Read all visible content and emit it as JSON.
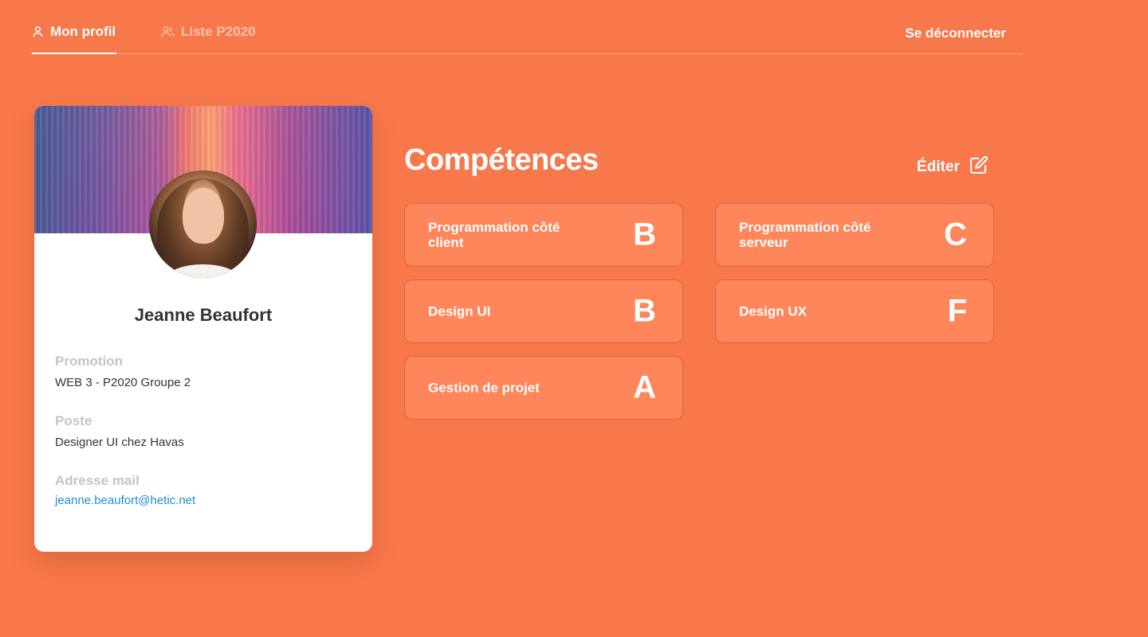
{
  "nav": {
    "tabs": [
      {
        "label": "Mon profil",
        "icon": "user-icon",
        "active": true
      },
      {
        "label": "Liste P2020",
        "icon": "users-icon",
        "active": false
      }
    ],
    "logout_label": "Se déconnecter"
  },
  "profile": {
    "name": "Jeanne Beaufort",
    "fields": [
      {
        "label": "Promotion",
        "value": "WEB 3 - P2020 Groupe 2"
      },
      {
        "label": "Poste",
        "value": "Designer UI chez Havas"
      },
      {
        "label": "Adresse mail",
        "value": "jeanne.beaufort@hetic.net"
      }
    ]
  },
  "skills": {
    "title": "Compétences",
    "edit_label": "Éditer",
    "items": [
      {
        "name": "Programmation côté client",
        "grade": "B"
      },
      {
        "name": "Programmation côté serveur",
        "grade": "C"
      },
      {
        "name": "Design UI",
        "grade": "B"
      },
      {
        "name": "Design UX",
        "grade": "F"
      },
      {
        "name": "Gestion de projet",
        "grade": "A"
      }
    ]
  },
  "colors": {
    "background": "#F7784B",
    "skill_card": "#FF865A",
    "link": "#1F8ED1"
  }
}
